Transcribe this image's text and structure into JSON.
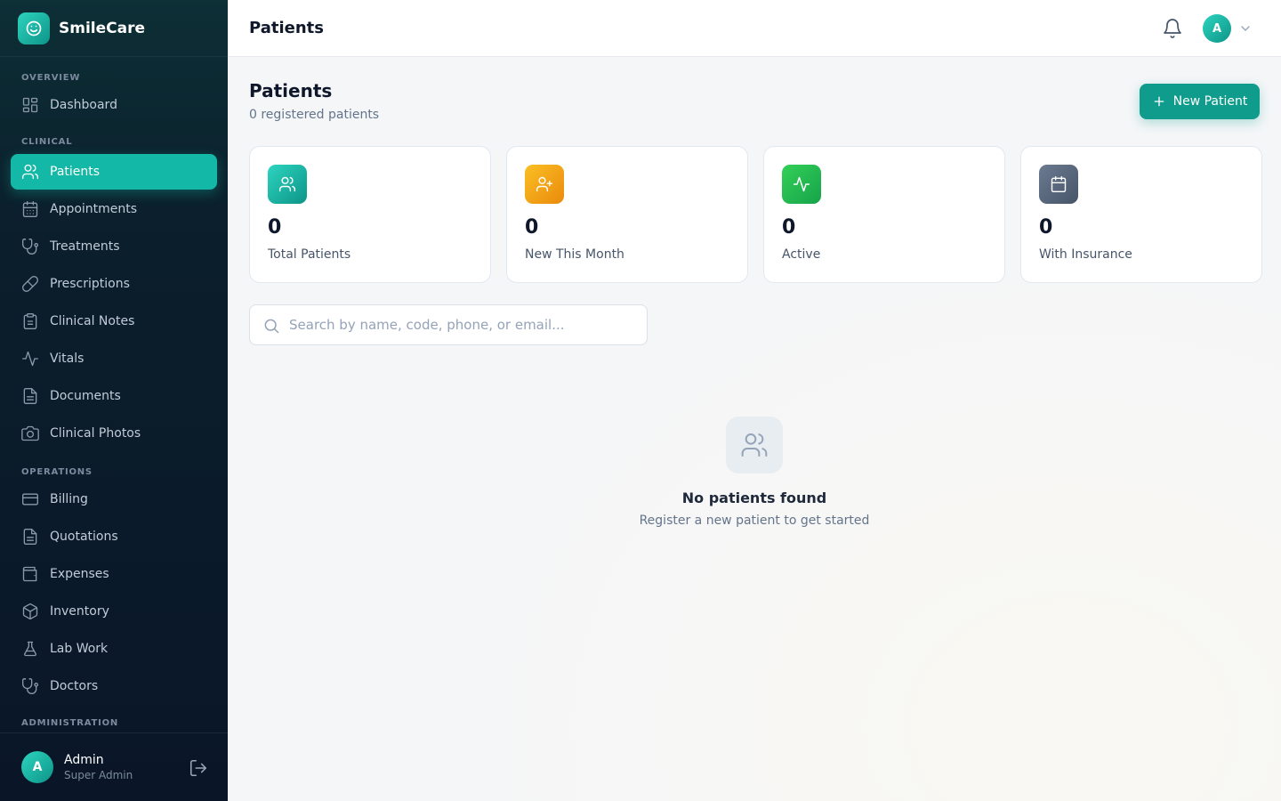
{
  "brand": {
    "name": "SmileCare"
  },
  "sidebar": {
    "sections": {
      "overview": "OVERVIEW",
      "clinical": "CLINICAL",
      "operations": "OPERATIONS",
      "administration": "ADMINISTRATION"
    },
    "items": {
      "dashboard": "Dashboard",
      "patients": "Patients",
      "appointments": "Appointments",
      "treatments": "Treatments",
      "prescriptions": "Prescriptions",
      "clinical_notes": "Clinical Notes",
      "vitals": "Vitals",
      "documents": "Documents",
      "clinical_photos": "Clinical Photos",
      "billing": "Billing",
      "quotations": "Quotations",
      "expenses": "Expenses",
      "inventory": "Inventory",
      "lab_work": "Lab Work",
      "doctors": "Doctors"
    },
    "active_item": "patients",
    "user": {
      "initial": "A",
      "name": "Admin",
      "role": "Super Admin"
    }
  },
  "header": {
    "title": "Patients",
    "avatar_initial": "A"
  },
  "main": {
    "title": "Patients",
    "subtitle": "0 registered patients",
    "new_button": "New Patient",
    "stats": [
      {
        "value": "0",
        "label": "Total Patients",
        "color": "#14b8a6",
        "icon": "users-icon"
      },
      {
        "value": "0",
        "label": "New This Month",
        "color": "#f59e0b",
        "icon": "user-plus-icon"
      },
      {
        "value": "0",
        "label": "Active",
        "color": "#22c55e",
        "icon": "activity-icon"
      },
      {
        "value": "0",
        "label": "With Insurance",
        "color": "#64748b",
        "icon": "calendar-icon"
      }
    ],
    "search": {
      "placeholder": "Search by name, code, phone, or email...",
      "value": ""
    },
    "empty": {
      "title": "No patients found",
      "subtitle": "Register a new patient to get started"
    }
  },
  "colors": {
    "accent": "#14b8a6",
    "sidebar_bg": "#0a1628"
  }
}
